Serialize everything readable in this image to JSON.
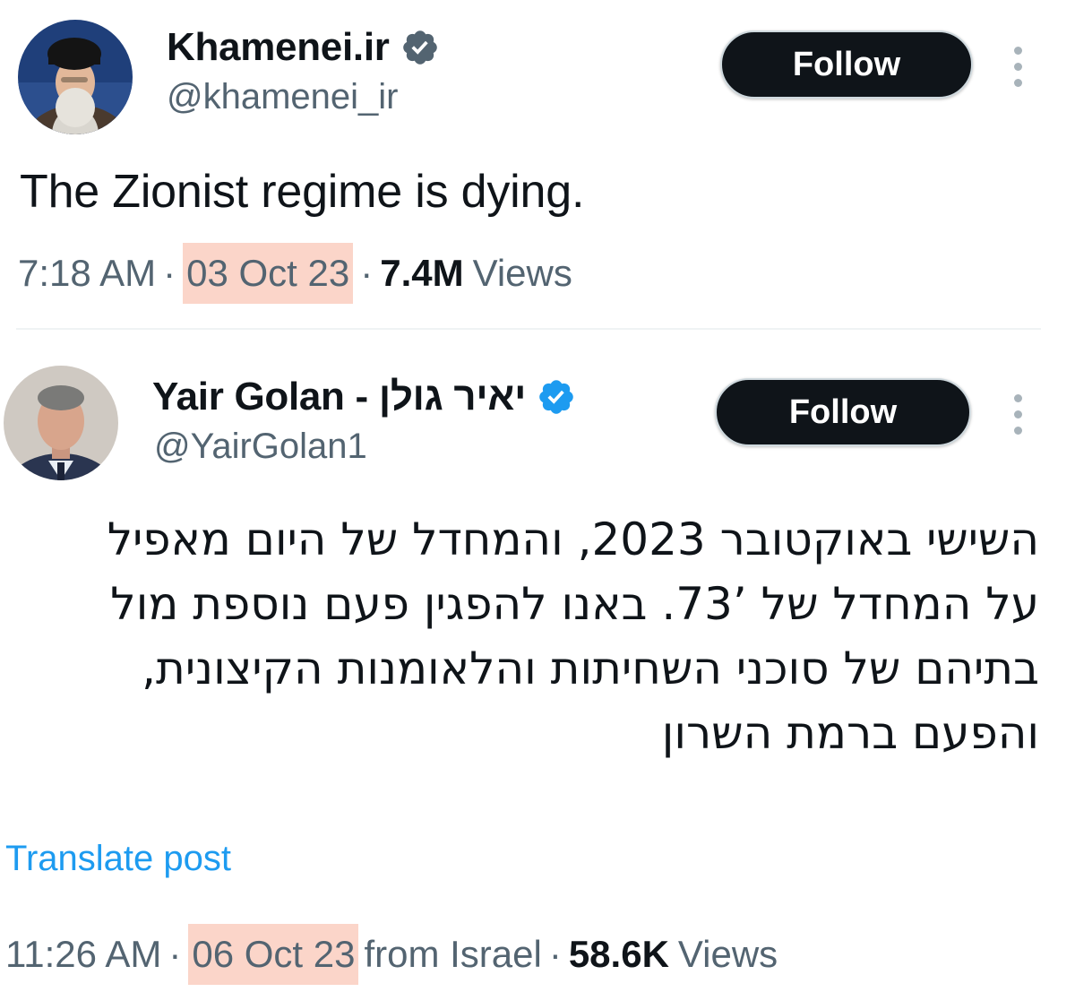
{
  "tweets": [
    {
      "display_name": "Khamenei.ir",
      "handle": "@khamenei_ir",
      "verified_icon": "verified-badge-icon",
      "verified_color": "#536471",
      "follow_label": "Follow",
      "text": "The Zionist regime is dying.",
      "time": "7:18 AM",
      "separator": "·",
      "date": "03 Oct 23",
      "views_count": "7.4M",
      "views_label": "Views"
    },
    {
      "display_name": "Yair Golan - יאיר גולן",
      "handle": "@YairGolan1",
      "verified_icon": "verified-badge-icon",
      "verified_color": "#1d9bf0",
      "follow_label": "Follow",
      "text_lines": [
        "השישי באוקטובר 2023, והמחדל של היום מאפיל",
        "על המחדל של ’73. באנו להפגין פעם נוספת מול",
        "בתיהם של סוכני השחיתות והלאומנות הקיצונית,",
        "והפעם ברמת השרון"
      ],
      "translate_label": "Translate post",
      "time": "11:26 AM",
      "separator": "·",
      "date": "06 Oct 23",
      "source": "from Israel",
      "views_count": "58.6K",
      "views_label": "Views"
    }
  ],
  "colors": {
    "highlight": "#fbd5c9",
    "follow_bg": "#0f1419",
    "link": "#1d9bf0",
    "secondary_text": "#536471"
  }
}
